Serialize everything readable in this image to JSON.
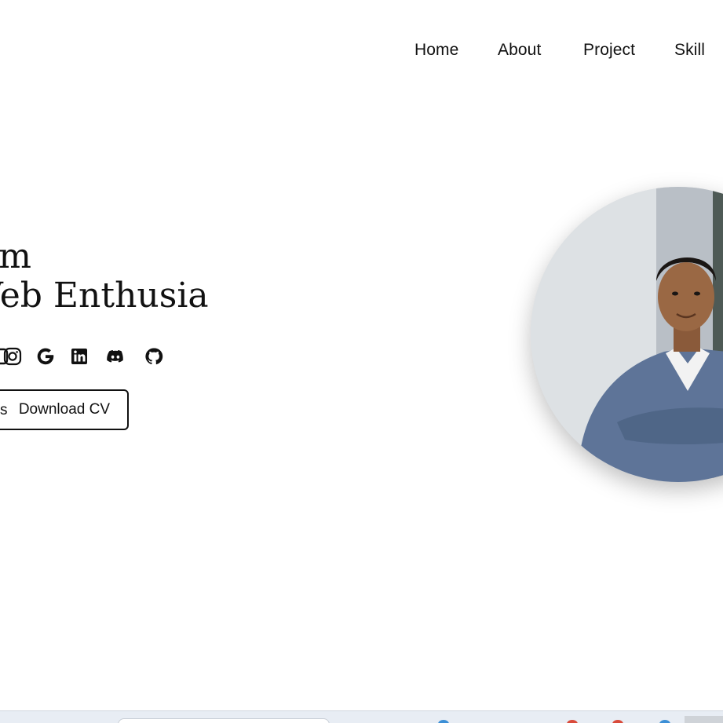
{
  "nav": {
    "items": [
      {
        "label": "Home"
      },
      {
        "label": "About"
      },
      {
        "label": "Project"
      },
      {
        "label": "Skill"
      }
    ]
  },
  "hero": {
    "line1": "am",
    "line2": "Veb Enthusia"
  },
  "socials": [
    {
      "icon": "instagram-icon"
    },
    {
      "icon": "google-icon"
    },
    {
      "icon": "linkedin-icon"
    },
    {
      "icon": "discord-icon"
    },
    {
      "icon": "github-icon"
    }
  ],
  "cta": {
    "download_label": "Download CV"
  },
  "colors": {
    "text": "#111111",
    "background": "#ffffff",
    "taskbar": "#e8edf4"
  }
}
